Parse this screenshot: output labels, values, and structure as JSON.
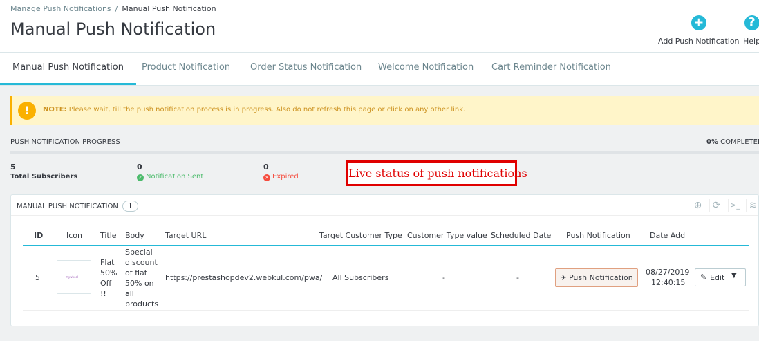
{
  "breadcrumb": {
    "parent": "Manage Push Notifications",
    "separator": "/",
    "current": "Manual Push Notification"
  },
  "page_title": "Manual Push Notification",
  "toolbar": {
    "add": {
      "label": "Add Push Notification",
      "icon": "plus-circle-icon"
    },
    "help": {
      "label": "Help",
      "icon": "question-circle-icon"
    }
  },
  "tabs": [
    {
      "label": "Manual Push Notification",
      "active": true
    },
    {
      "label": "Product Notification",
      "active": false
    },
    {
      "label": "Order Status Notification",
      "active": false
    },
    {
      "label": "Welcome Notification",
      "active": false
    },
    {
      "label": "Cart Reminder Notification",
      "active": false
    }
  ],
  "alert": {
    "prefix": "NOTE:",
    "message": "Please wait, till the push notification process is in progress. Also do not refresh this page or click on any other link."
  },
  "progress": {
    "title": "PUSH NOTIFICATION PROGRESS",
    "percent_label": "0%",
    "completed_label": "COMPLETED",
    "fraction": 0.0
  },
  "stats": {
    "total": {
      "value": "5",
      "label": "Total Subscribers"
    },
    "sent": {
      "value": "0",
      "label": "Notification Sent"
    },
    "expired": {
      "value": "0",
      "label": "Expired"
    }
  },
  "annotation": "Live status of push notifications",
  "panel": {
    "title": "MANUAL PUSH NOTIFICATION",
    "count": "1",
    "columns": [
      "ID",
      "Icon",
      "Title",
      "Body",
      "Target URL",
      "Target Customer Type",
      "Customer Type value",
      "Scheduled Date",
      "Push Notification",
      "Date Add"
    ],
    "row": {
      "id": "5",
      "icon_text": "mywheel",
      "title": "Flat 50% Off !!",
      "body": "Special discount of flat 50% on all products",
      "target_url": "https://prestashopdev2.webkul.com/pwa/",
      "customer_type": "All Subscribers",
      "customer_type_value": "-",
      "scheduled_date": "-",
      "push_label": "Push Notification",
      "date_add": "08/27/2019",
      "time_add": "12:40:15",
      "edit_label": "Edit"
    }
  },
  "colors": {
    "accent": "#25b9d7",
    "warning": "#fab000",
    "success": "#4cbb6c",
    "danger": "#f54c3e",
    "annotation": "#e00000"
  }
}
